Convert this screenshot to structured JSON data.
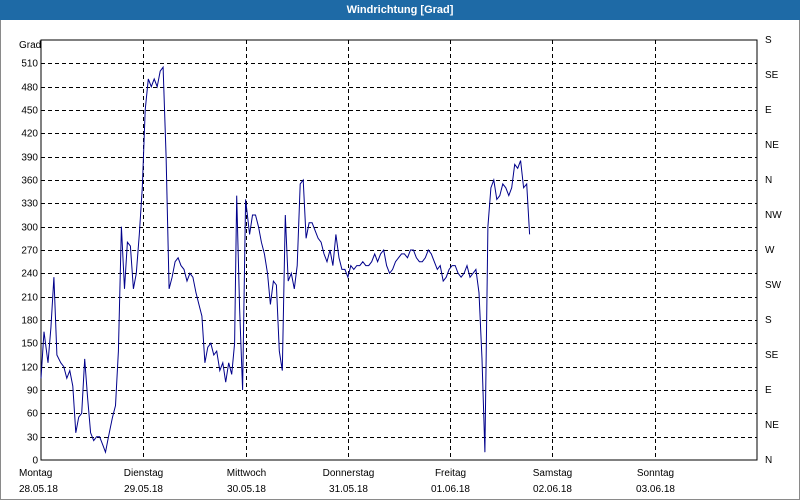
{
  "title": "Windrichtung [Grad]",
  "chart_data": {
    "type": "line",
    "title": "Windrichtung [Grad]",
    "ylabel": "Grad",
    "ylim": [
      0,
      540
    ],
    "yticks": [
      0,
      30,
      60,
      90,
      120,
      150,
      180,
      210,
      240,
      270,
      300,
      330,
      360,
      390,
      420,
      450,
      480,
      510
    ],
    "y2_ticks": [
      {
        "value": 0,
        "label": "N"
      },
      {
        "value": 45,
        "label": "NE"
      },
      {
        "value": 90,
        "label": "E"
      },
      {
        "value": 135,
        "label": "SE"
      },
      {
        "value": 180,
        "label": "S"
      },
      {
        "value": 225,
        "label": "SW"
      },
      {
        "value": 270,
        "label": "W"
      },
      {
        "value": 315,
        "label": "NW"
      },
      {
        "value": 360,
        "label": "N"
      },
      {
        "value": 405,
        "label": "NE"
      },
      {
        "value": 450,
        "label": "E"
      },
      {
        "value": 495,
        "label": "SE"
      },
      {
        "value": 540,
        "label": "S"
      }
    ],
    "x_unit": "days since Montag 28.05.18 00:00",
    "xlim": [
      0,
      7
    ],
    "x_ticks": [
      {
        "value": 0,
        "day": "Montag",
        "date": "28.05.18"
      },
      {
        "value": 1,
        "day": "Dienstag",
        "date": "29.05.18"
      },
      {
        "value": 2,
        "day": "Mittwoch",
        "date": "30.05.18"
      },
      {
        "value": 3,
        "day": "Donnerstag",
        "date": "31.05.18"
      },
      {
        "value": 4,
        "day": "Freitag",
        "date": "01.06.18"
      },
      {
        "value": 5,
        "day": "Samstag",
        "date": "02.06.18"
      },
      {
        "value": 6,
        "day": "Sonntag",
        "date": "03.06.18"
      }
    ],
    "grid": true,
    "line_color": "#00008b",
    "series": [
      {
        "values": [
          [
            0.0,
            105
          ],
          [
            0.029,
            165
          ],
          [
            0.068,
            125
          ],
          [
            0.097,
            170
          ],
          [
            0.126,
            235
          ],
          [
            0.155,
            135
          ],
          [
            0.194,
            125
          ],
          [
            0.223,
            120
          ],
          [
            0.252,
            105
          ],
          [
            0.282,
            115
          ],
          [
            0.311,
            95
          ],
          [
            0.34,
            35
          ],
          [
            0.369,
            55
          ],
          [
            0.398,
            60
          ],
          [
            0.427,
            130
          ],
          [
            0.456,
            80
          ],
          [
            0.485,
            35
          ],
          [
            0.515,
            25
          ],
          [
            0.544,
            30
          ],
          [
            0.573,
            30
          ],
          [
            0.602,
            20
          ],
          [
            0.631,
            10
          ],
          [
            0.66,
            30
          ],
          [
            0.699,
            55
          ],
          [
            0.728,
            70
          ],
          [
            0.757,
            140
          ],
          [
            0.786,
            300
          ],
          [
            0.816,
            220
          ],
          [
            0.845,
            280
          ],
          [
            0.874,
            275
          ],
          [
            0.903,
            220
          ],
          [
            0.932,
            240
          ],
          [
            0.961,
            290
          ],
          [
            0.99,
            350
          ],
          [
            1.019,
            450
          ],
          [
            1.049,
            490
          ],
          [
            1.078,
            480
          ],
          [
            1.107,
            490
          ],
          [
            1.136,
            480
          ],
          [
            1.165,
            500
          ],
          [
            1.194,
            505
          ],
          [
            1.223,
            390
          ],
          [
            1.252,
            220
          ],
          [
            1.282,
            235
          ],
          [
            1.311,
            255
          ],
          [
            1.34,
            260
          ],
          [
            1.369,
            250
          ],
          [
            1.398,
            245
          ],
          [
            1.427,
            230
          ],
          [
            1.456,
            240
          ],
          [
            1.485,
            235
          ],
          [
            1.515,
            215
          ],
          [
            1.544,
            200
          ],
          [
            1.573,
            185
          ],
          [
            1.602,
            125
          ],
          [
            1.631,
            145
          ],
          [
            1.66,
            150
          ],
          [
            1.689,
            135
          ],
          [
            1.718,
            140
          ],
          [
            1.748,
            115
          ],
          [
            1.777,
            125
          ],
          [
            1.806,
            100
          ],
          [
            1.835,
            125
          ],
          [
            1.864,
            110
          ],
          [
            1.893,
            150
          ],
          [
            1.913,
            340
          ],
          [
            1.942,
            195
          ],
          [
            1.971,
            90
          ],
          [
            2.0,
            335
          ],
          [
            2.039,
            290
          ],
          [
            2.068,
            315
          ],
          [
            2.097,
            315
          ],
          [
            2.126,
            300
          ],
          [
            2.155,
            280
          ],
          [
            2.184,
            265
          ],
          [
            2.214,
            240
          ],
          [
            2.243,
            200
          ],
          [
            2.272,
            230
          ],
          [
            2.301,
            225
          ],
          [
            2.33,
            140
          ],
          [
            2.359,
            115
          ],
          [
            2.388,
            315
          ],
          [
            2.417,
            230
          ],
          [
            2.447,
            240
          ],
          [
            2.476,
            220
          ],
          [
            2.505,
            250
          ],
          [
            2.534,
            355
          ],
          [
            2.563,
            360
          ],
          [
            2.592,
            285
          ],
          [
            2.621,
            305
          ],
          [
            2.65,
            305
          ],
          [
            2.68,
            295
          ],
          [
            2.709,
            285
          ],
          [
            2.738,
            280
          ],
          [
            2.767,
            265
          ],
          [
            2.796,
            255
          ],
          [
            2.825,
            270
          ],
          [
            2.854,
            250
          ],
          [
            2.883,
            290
          ],
          [
            2.913,
            260
          ],
          [
            2.942,
            245
          ],
          [
            2.971,
            245
          ],
          [
            3.0,
            235
          ],
          [
            3.029,
            250
          ],
          [
            3.058,
            245
          ],
          [
            3.087,
            250
          ],
          [
            3.117,
            250
          ],
          [
            3.146,
            255
          ],
          [
            3.175,
            250
          ],
          [
            3.204,
            250
          ],
          [
            3.233,
            255
          ],
          [
            3.262,
            265
          ],
          [
            3.291,
            255
          ],
          [
            3.32,
            265
          ],
          [
            3.35,
            270
          ],
          [
            3.379,
            250
          ],
          [
            3.408,
            240
          ],
          [
            3.437,
            245
          ],
          [
            3.466,
            255
          ],
          [
            3.495,
            260
          ],
          [
            3.524,
            265
          ],
          [
            3.553,
            265
          ],
          [
            3.583,
            260
          ],
          [
            3.612,
            270
          ],
          [
            3.641,
            270
          ],
          [
            3.67,
            260
          ],
          [
            3.699,
            255
          ],
          [
            3.728,
            255
          ],
          [
            3.757,
            260
          ],
          [
            3.786,
            270
          ],
          [
            3.816,
            265
          ],
          [
            3.845,
            255
          ],
          [
            3.874,
            245
          ],
          [
            3.903,
            250
          ],
          [
            3.932,
            230
          ],
          [
            3.961,
            235
          ],
          [
            3.99,
            245
          ],
          [
            4.019,
            250
          ],
          [
            4.049,
            250
          ],
          [
            4.078,
            240
          ],
          [
            4.107,
            235
          ],
          [
            4.136,
            240
          ],
          [
            4.165,
            250
          ],
          [
            4.194,
            235
          ],
          [
            4.223,
            240
          ],
          [
            4.252,
            245
          ],
          [
            4.282,
            215
          ],
          [
            4.311,
            130
          ],
          [
            4.34,
            10
          ],
          [
            4.369,
            300
          ],
          [
            4.398,
            350
          ],
          [
            4.427,
            360
          ],
          [
            4.456,
            335
          ],
          [
            4.485,
            340
          ],
          [
            4.515,
            355
          ],
          [
            4.544,
            350
          ],
          [
            4.573,
            340
          ],
          [
            4.602,
            350
          ],
          [
            4.631,
            380
          ],
          [
            4.66,
            375
          ],
          [
            4.689,
            385
          ],
          [
            4.718,
            350
          ],
          [
            4.748,
            355
          ],
          [
            4.777,
            290
          ]
        ]
      }
    ]
  }
}
